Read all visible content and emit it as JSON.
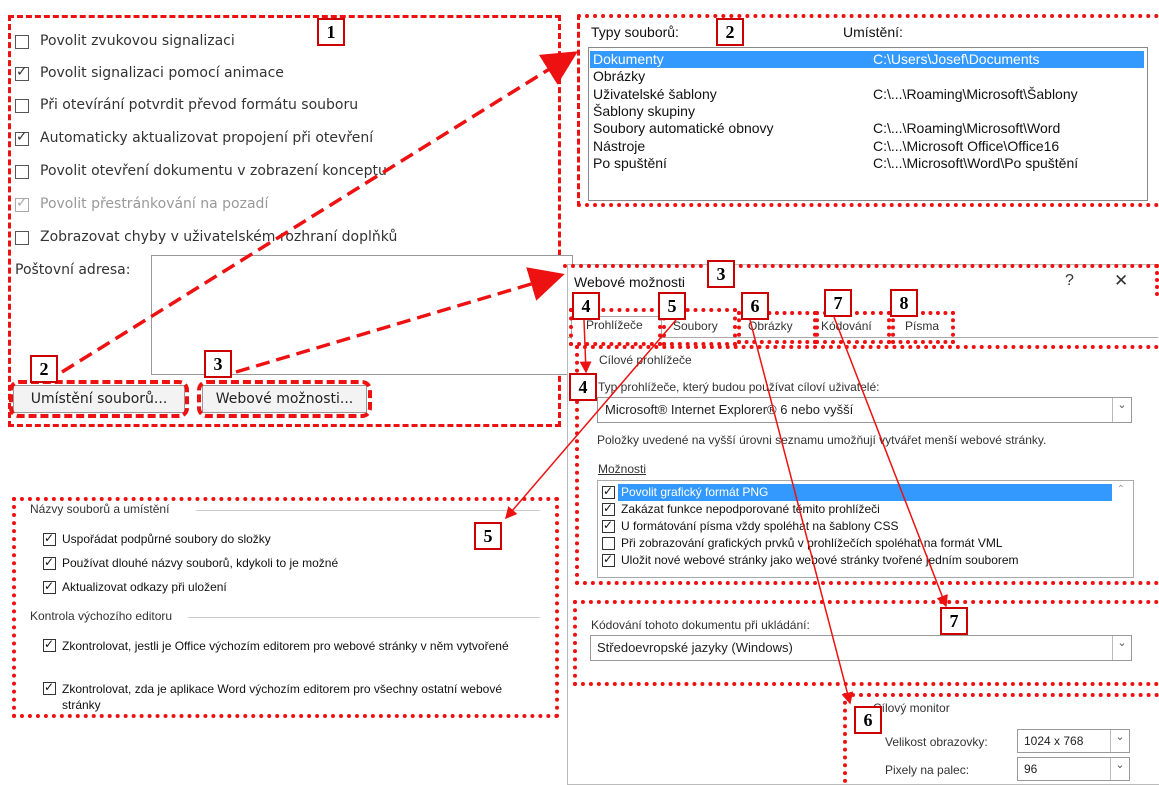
{
  "options_panel": {
    "checkboxes": [
      {
        "label": "Povolit zvukovou signalizaci",
        "checked": false,
        "disabled": false
      },
      {
        "label": "Povolit signalizaci pomocí animace",
        "checked": true,
        "disabled": false
      },
      {
        "label": "Při otevírání potvrdit převod formátu souboru",
        "checked": false,
        "disabled": false
      },
      {
        "label": "Automaticky aktualizovat propojení při otevření",
        "checked": true,
        "disabled": false
      },
      {
        "label": "Povolit otevření dokumentu v zobrazení konceptu",
        "checked": false,
        "disabled": false
      },
      {
        "label": "Povolit přestránkování na pozadí",
        "checked": true,
        "disabled": true
      },
      {
        "label": "Zobrazovat chyby v uživatelském rozhraní doplňků",
        "checked": false,
        "disabled": false
      }
    ],
    "mailing_address_label": "Poštovní adresa:",
    "file_locations_button": "Umístění souborů...",
    "web_options_button": "Webové možnosti..."
  },
  "file_locations": {
    "col_type": "Typy souborů:",
    "col_location": "Umístění:",
    "rows": [
      {
        "type": "Dokumenty",
        "location": "C:\\Users\\Josef\\Documents",
        "selected": true
      },
      {
        "type": "Obrázky",
        "location": "",
        "selected": false
      },
      {
        "type": "Uživatelské šablony",
        "location": "C:\\...\\Roaming\\Microsoft\\Šablony",
        "selected": false
      },
      {
        "type": "Šablony skupiny",
        "location": "",
        "selected": false
      },
      {
        "type": "Soubory automatické obnovy",
        "location": "C:\\...\\Roaming\\Microsoft\\Word",
        "selected": false
      },
      {
        "type": "Nástroje",
        "location": "C:\\...\\Microsoft Office\\Office16",
        "selected": false
      },
      {
        "type": "Po spuštění",
        "location": "C:\\...\\Microsoft\\Word\\Po spuštění",
        "selected": false
      }
    ]
  },
  "web_options": {
    "title": "Webové možnosti",
    "help": "?",
    "close": "✕",
    "tabs": [
      "Prohlížeče",
      "Soubory",
      "Obrázky",
      "Kódování",
      "Písma"
    ],
    "target_browsers_group": "Cílové prohlížeče",
    "browser_type_label": "Typ prohlížeče, který budou používat cíloví uživatelé:",
    "browser_value": "Microsoft® Internet Explorer® 6 nebo vyšší",
    "browser_hint": "Položky uvedené na vyšší úrovni seznamu umožňují vytvářet menší webové stránky.",
    "options_label": "Možnosti",
    "options": [
      {
        "label": "Povolit grafický formát PNG",
        "checked": true,
        "selected": true
      },
      {
        "label": "Zakázat funkce nepodporované těmito prohlížeči",
        "checked": true,
        "selected": false
      },
      {
        "label": "U formátování písma vždy spoléhat na šablony CSS",
        "checked": true,
        "selected": false
      },
      {
        "label": "Při zobrazování grafických prvků v prohlížečích spoléhat na formát VML",
        "checked": false,
        "selected": false
      },
      {
        "label": "Uložit nové webové stránky jako webové stránky tvořené jedním souborem",
        "checked": true,
        "selected": false
      }
    ],
    "encoding_label": "Kódování tohoto dokumentu při ukládání:",
    "encoding_value": "Středoevropské jazyky (Windows)"
  },
  "files_tab": {
    "group1": "Názvy souborů a umístění",
    "group1_items": [
      {
        "label": "Uspořádat podpůrné soubory do složky",
        "checked": true
      },
      {
        "label": "Používat dlouhé názvy souborů, kdykoli to je možné",
        "checked": true
      },
      {
        "label": "Aktualizovat odkazy při uložení",
        "checked": true
      }
    ],
    "group2": "Kontrola výchozího editoru",
    "group2_items": [
      {
        "label": "Zkontrolovat, jestli je Office výchozím editorem pro webové stránky v něm vytvořené",
        "checked": true
      },
      {
        "label": "Zkontrolovat, zda je aplikace Word výchozím editorem pro všechny ostatní webové stránky",
        "checked": true
      }
    ]
  },
  "pictures_tab": {
    "group": "Cílový monitor",
    "screen_size_label": "Velikost obrazovky:",
    "screen_size_value": "1024 x 768",
    "ppi_label": "Pixely na palec:",
    "ppi_value": "96"
  },
  "callouts": [
    "1",
    "2",
    "3",
    "4",
    "5",
    "6",
    "7",
    "8"
  ],
  "colors": {
    "annotation": "#ee1111",
    "selection": "#3399ff"
  }
}
